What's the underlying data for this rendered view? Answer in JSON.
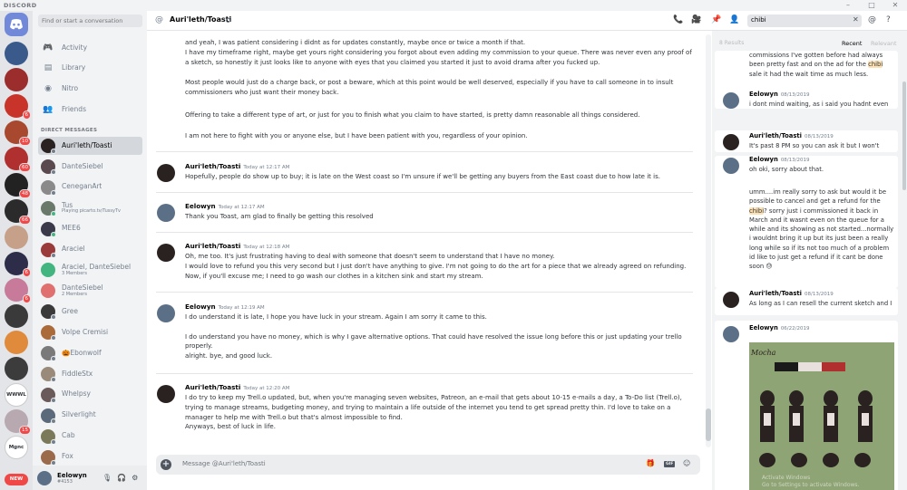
{
  "app": {
    "brand": "DISCORD"
  },
  "window_controls": [
    "–",
    "□",
    "✕"
  ],
  "servers": [
    {
      "initials": "",
      "color": "#3a5a8c",
      "badge": "",
      "active": false
    },
    {
      "initials": "",
      "color": "#9b2d2d",
      "badge": "",
      "active": false
    },
    {
      "initials": "",
      "color": "#c9342a",
      "badge": "6",
      "active": false
    },
    {
      "initials": "",
      "color": "#a8482e",
      "badge": "10",
      "active": false
    },
    {
      "initials": "",
      "color": "#b03030",
      "badge": "60",
      "active": false
    },
    {
      "initials": "",
      "color": "#222222",
      "badge": "48",
      "active": false
    },
    {
      "initials": "",
      "color": "#2b2b2b",
      "badge": "66",
      "active": false
    },
    {
      "initials": "",
      "color": "#c7a08a",
      "badge": "",
      "active": false
    },
    {
      "initials": "",
      "color": "#2d2d4a",
      "badge": "6",
      "active": false
    },
    {
      "initials": "",
      "color": "#c77a9a",
      "badge": "6",
      "active": false
    },
    {
      "initials": "",
      "color": "#3a3a3a",
      "badge": "",
      "active": false
    },
    {
      "initials": "",
      "color": "#e08a3c",
      "badge": "",
      "active": false
    },
    {
      "initials": "",
      "color": "#3c3c3c",
      "badge": "",
      "active": false
    },
    {
      "initials": "WWWL",
      "color": "#ffffff",
      "badge": "",
      "active": false
    },
    {
      "initials": "",
      "color": "#b8a8b0",
      "badge": "15",
      "active": false
    },
    {
      "initials": "Mgnc",
      "color": "#ffffff",
      "badge": "",
      "active": false
    }
  ],
  "new_badge": "NEW",
  "dm_search_placeholder": "Find or start a conversation",
  "nav": [
    {
      "icon": "🎮",
      "label": "Activity"
    },
    {
      "icon": "▤",
      "label": "Library"
    },
    {
      "icon": "◉",
      "label": "Nitro"
    },
    {
      "icon": "👥",
      "label": "Friends"
    }
  ],
  "dm_header": "DIRECT MESSAGES",
  "dms": [
    {
      "name": "Auri'leth/Toasti",
      "sub": "",
      "color": "#2a2220",
      "status": "#747f8d",
      "active": true
    },
    {
      "name": "DanteSiebel",
      "sub": "",
      "color": "#5a4a50",
      "status": "#747f8d",
      "active": false
    },
    {
      "name": "CeneganArt",
      "sub": "",
      "color": "#8a8a8a",
      "status": "#747f8d",
      "active": false
    },
    {
      "name": "Tus",
      "sub": "Playing picarto.tv/TussyTv",
      "color": "#6a7a6a",
      "status": "#43b581",
      "active": false
    },
    {
      "name": "MEE6",
      "sub": "",
      "color": "#3a3a4a",
      "status": "#43b581",
      "active": false
    },
    {
      "name": "Araciel",
      "sub": "",
      "color": "#9a3a3a",
      "status": "#747f8d",
      "active": false
    },
    {
      "name": "Araciel, DanteSiebel",
      "sub": "3 Members",
      "color": "#43b581",
      "status": "",
      "active": false
    },
    {
      "name": "DanteSiebel",
      "sub": "2 Members",
      "color": "#e07070",
      "status": "",
      "active": false
    },
    {
      "name": "Gree",
      "sub": "",
      "color": "#3a3a3a",
      "status": "#747f8d",
      "active": false
    },
    {
      "name": "Volpe Cremisi",
      "sub": "",
      "color": "#aa6a3a",
      "status": "#747f8d",
      "active": false
    },
    {
      "name": "🎃Ebonwolf",
      "sub": "",
      "color": "#7a7a7a",
      "status": "#747f8d",
      "active": false
    },
    {
      "name": "FiddleStx",
      "sub": "",
      "color": "#9a8a7a",
      "status": "#747f8d",
      "active": false
    },
    {
      "name": "Whelpsy",
      "sub": "",
      "color": "#6a5a5a",
      "status": "#747f8d",
      "active": false
    },
    {
      "name": "Silverlight",
      "sub": "",
      "color": "#5a6a7a",
      "status": "#747f8d",
      "active": false
    },
    {
      "name": "Cab",
      "sub": "",
      "color": "#7a7a5a",
      "status": "#747f8d",
      "active": false
    },
    {
      "name": "Fox",
      "sub": "",
      "color": "#9a6a4a",
      "status": "#747f8d",
      "active": false
    }
  ],
  "user": {
    "name": "Eelowyn",
    "tag": "#4153"
  },
  "chat": {
    "channel": "Auri'leth/Toasti",
    "search_query": "chibi",
    "composer_placeholder": "Message @Auri'leth/Toasti",
    "gif_label": "GIF"
  },
  "continuation": [
    "and yeah, I was patient considering i didnt as for updates constantly, maybe once or twice a month if that.",
    "I have my timeframe right, maybe get yours right considering you forgot about even adding my commission to your queue. There was never even any proof of a sketch, so honestly it just looks like to anyone with eyes that you claimed you started it just to avoid drama after you fucked up.",
    "Most people would just do a charge back, or post a beware, which at this point would be well deserved, especially if you have to call someone in to insult commissioners who just want their money back.",
    "Offering to take a different type of art, or just for you to finish what you claim to have started, is pretty damn reasonable all things considered.",
    "I am not here to fight with you or anyone else, but I have been patient with you, regardless of your opinion."
  ],
  "messages": [
    {
      "author": "Auri'leth/Toasti",
      "time": "Today at 12:17 AM",
      "avatar": "#2a2220",
      "lines": [
        "Hopefully, people do show up to buy; it is late on the West coast so I'm unsure if we'll be getting any buyers from the East coast due to how late it is."
      ]
    },
    {
      "author": "Eelowyn",
      "time": "Today at 12:17 AM",
      "avatar": "#5b6f86",
      "lines": [
        "Thank you Toast, am glad to finally be getting this resolved"
      ]
    },
    {
      "author": "Auri'leth/Toasti",
      "time": "Today at 12:18 AM",
      "avatar": "#2a2220",
      "lines": [
        "Oh, me too. It's just frustrating having to deal with someone that doesn't seem to understand that I have no money.",
        "I would love to refund you this very second but I just don't have anything to give. I'm not going to do the art for a piece that we already agreed on refunding.",
        "Now, if you'll excuse me; I need to go wash our clothes in a kitchen sink and start my stream."
      ]
    },
    {
      "author": "Eelowyn",
      "time": "Today at 12:19 AM",
      "avatar": "#5b6f86",
      "lines": [
        "I do understand it is late, I hope you have luck in your stream. Again I am sorry it came to this.",
        "",
        "I do understand you have no money, which is why I gave alternative options. That could have resolved the issue long before this or just updating your trello properly.",
        "alright. bye, and good luck."
      ]
    },
    {
      "author": "Auri'leth/Toasti",
      "time": "Today at 12:20 AM",
      "avatar": "#2a2220",
      "lines": [
        "I do try to keep my Trell.o updated, but, when you're managing seven websites, Patreon, an e-mail that gets about 10-15 e-mails a day, a To-Do list (Trell.o), trying to manage streams, budgeting money, and trying to maintain a life outside of the internet you tend to get spread pretty thin. I'd love to take on a manager to help me with Trell.o but that's almost impossible to find.",
        "Anyways, best of luck in life."
      ]
    }
  ],
  "results": {
    "count_label": "8 Results",
    "tab_recent": "Recent",
    "tab_relevant": "Relevant",
    "items": [
      {
        "author": "",
        "time": "",
        "avatar": "",
        "pre": "commissions I've gotten before had always been pretty fast and on the ad for the ",
        "hl": "chibi",
        "post": " sale it had the wait time as much less."
      },
      {
        "author": "Eelowyn",
        "time": "08/13/2019",
        "avatar": "#5b6f86",
        "pre": "i dont mind waiting, as i said you hadnt even",
        "hl": "",
        "post": ""
      },
      {
        "author": "Auri'leth/Toasti",
        "time": "08/13/2019",
        "avatar": "#2a2220",
        "pre": "It's past 8 PM so you can ask it but I won't",
        "hl": "",
        "post": ""
      },
      {
        "author": "Eelowyn",
        "time": "08/13/2019",
        "avatar": "#5b6f86",
        "pre": "oh oki, sorry about that.",
        "hl": "",
        "post": ""
      },
      {
        "author": "",
        "time": "",
        "avatar": "",
        "pre": "umm....im really sorry to ask but would it be possible to cancel and get a refund for the ",
        "hl": "chibi",
        "post": "? sorry just i commissioned it back in March  and it wasnt even on the queue for a while and its showing as not started...normally i wouldnt bring it up but its just been a really long while so if its not too much of a problem id like to just get a refund if it cant be done soon 😓"
      },
      {
        "author": "Auri'leth/Toasti",
        "time": "08/13/2019",
        "avatar": "#2a2220",
        "pre": "As long as I can resell the current sketch and I",
        "hl": "",
        "post": ""
      },
      {
        "author": "Eelowyn",
        "time": "06/22/2019",
        "avatar": "#5b6f86",
        "pre": "",
        "hl": "",
        "post": ""
      }
    ],
    "image_overlay": "Activate Windows\nGo to Settings to activate Windows."
  }
}
